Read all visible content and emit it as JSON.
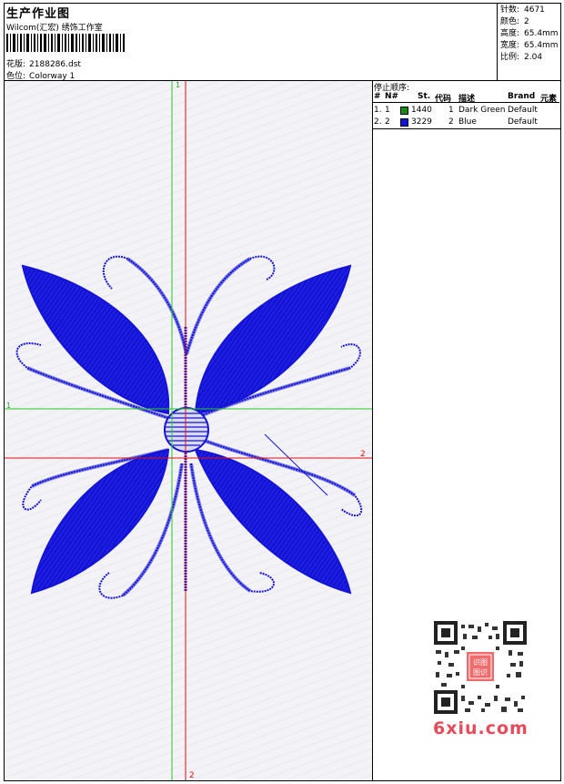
{
  "header": {
    "title": "生产作业图",
    "company": "Wilcom(汇宏) 绣饰工作室",
    "design_label": "花版:",
    "design_value": "2188286.dst",
    "colorway_label": "色位:",
    "colorway_value": "Colorway 1"
  },
  "stats": [
    {
      "label": "针数:",
      "value": "4671"
    },
    {
      "label": "颜色:",
      "value": "2"
    },
    {
      "label": "高度:",
      "value": "65.4mm"
    },
    {
      "label": "宽度:",
      "value": "65.4mm"
    },
    {
      "label": "比例:",
      "value": "2.04"
    }
  ],
  "stop_sequence": {
    "title": "停止顺序:",
    "columns": [
      "#",
      "N#",
      "St.",
      "代码",
      "描述",
      "Brand",
      "元素"
    ],
    "rows": [
      {
        "idx": "1.",
        "n": "1",
        "color": "#1a8a1a",
        "st": "1440",
        "code": "1",
        "desc": "Dark Green",
        "brand": "Default"
      },
      {
        "idx": "2.",
        "n": "2",
        "color": "#1414d8",
        "st": "3229",
        "code": "2",
        "desc": "Blue",
        "brand": "Default"
      }
    ]
  },
  "canvas": {
    "green_h_label": "1",
    "green_v_label": "1",
    "red_h_label": "2",
    "red_v_label": "2",
    "colors": {
      "stitch": "#1414d8",
      "guide_green": "#22cc22",
      "guide_red": "#e01010"
    }
  },
  "watermark": {
    "text": "6xiu.com",
    "seal": "识图\n图识"
  }
}
